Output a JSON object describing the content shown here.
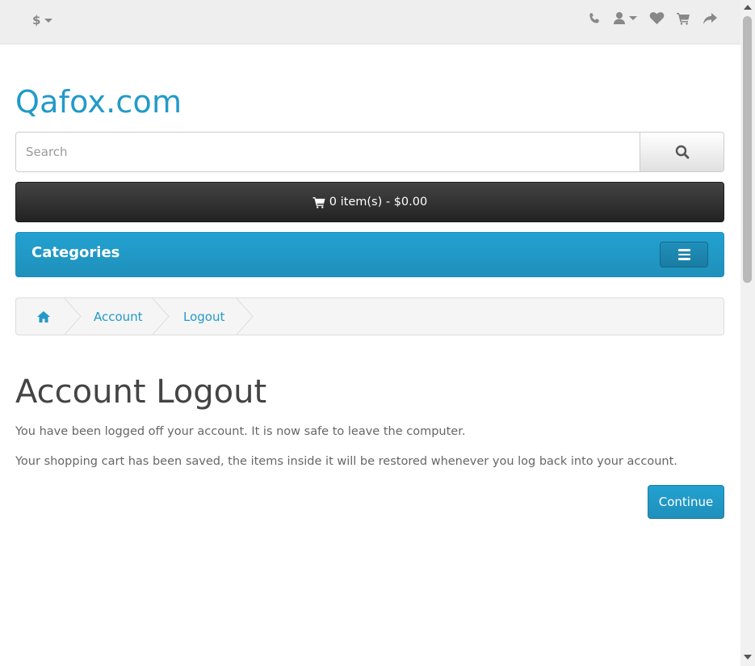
{
  "topbar": {
    "currency_symbol": "$",
    "icons": [
      "phone-icon",
      "user-icon",
      "heart-icon",
      "cart-icon",
      "share-icon"
    ]
  },
  "brand": {
    "logo": "Qafox.com",
    "color": "#229ac8"
  },
  "search": {
    "placeholder": "Search",
    "value": ""
  },
  "cart": {
    "label": "0 item(s) - $0.00"
  },
  "categories": {
    "title": "Categories"
  },
  "breadcrumb": {
    "items": [
      "Account",
      "Logout"
    ]
  },
  "page": {
    "title": "Account Logout",
    "message1": "You have been logged off your account. It is now safe to leave the computer.",
    "message2": "Your shopping cart has been saved, the items inside it will be restored whenever you log back into your account.",
    "continue_label": "Continue"
  },
  "colors": {
    "accent": "#229ac8",
    "topbar_bg": "#eeeeee",
    "cart_bg": "#222222"
  }
}
